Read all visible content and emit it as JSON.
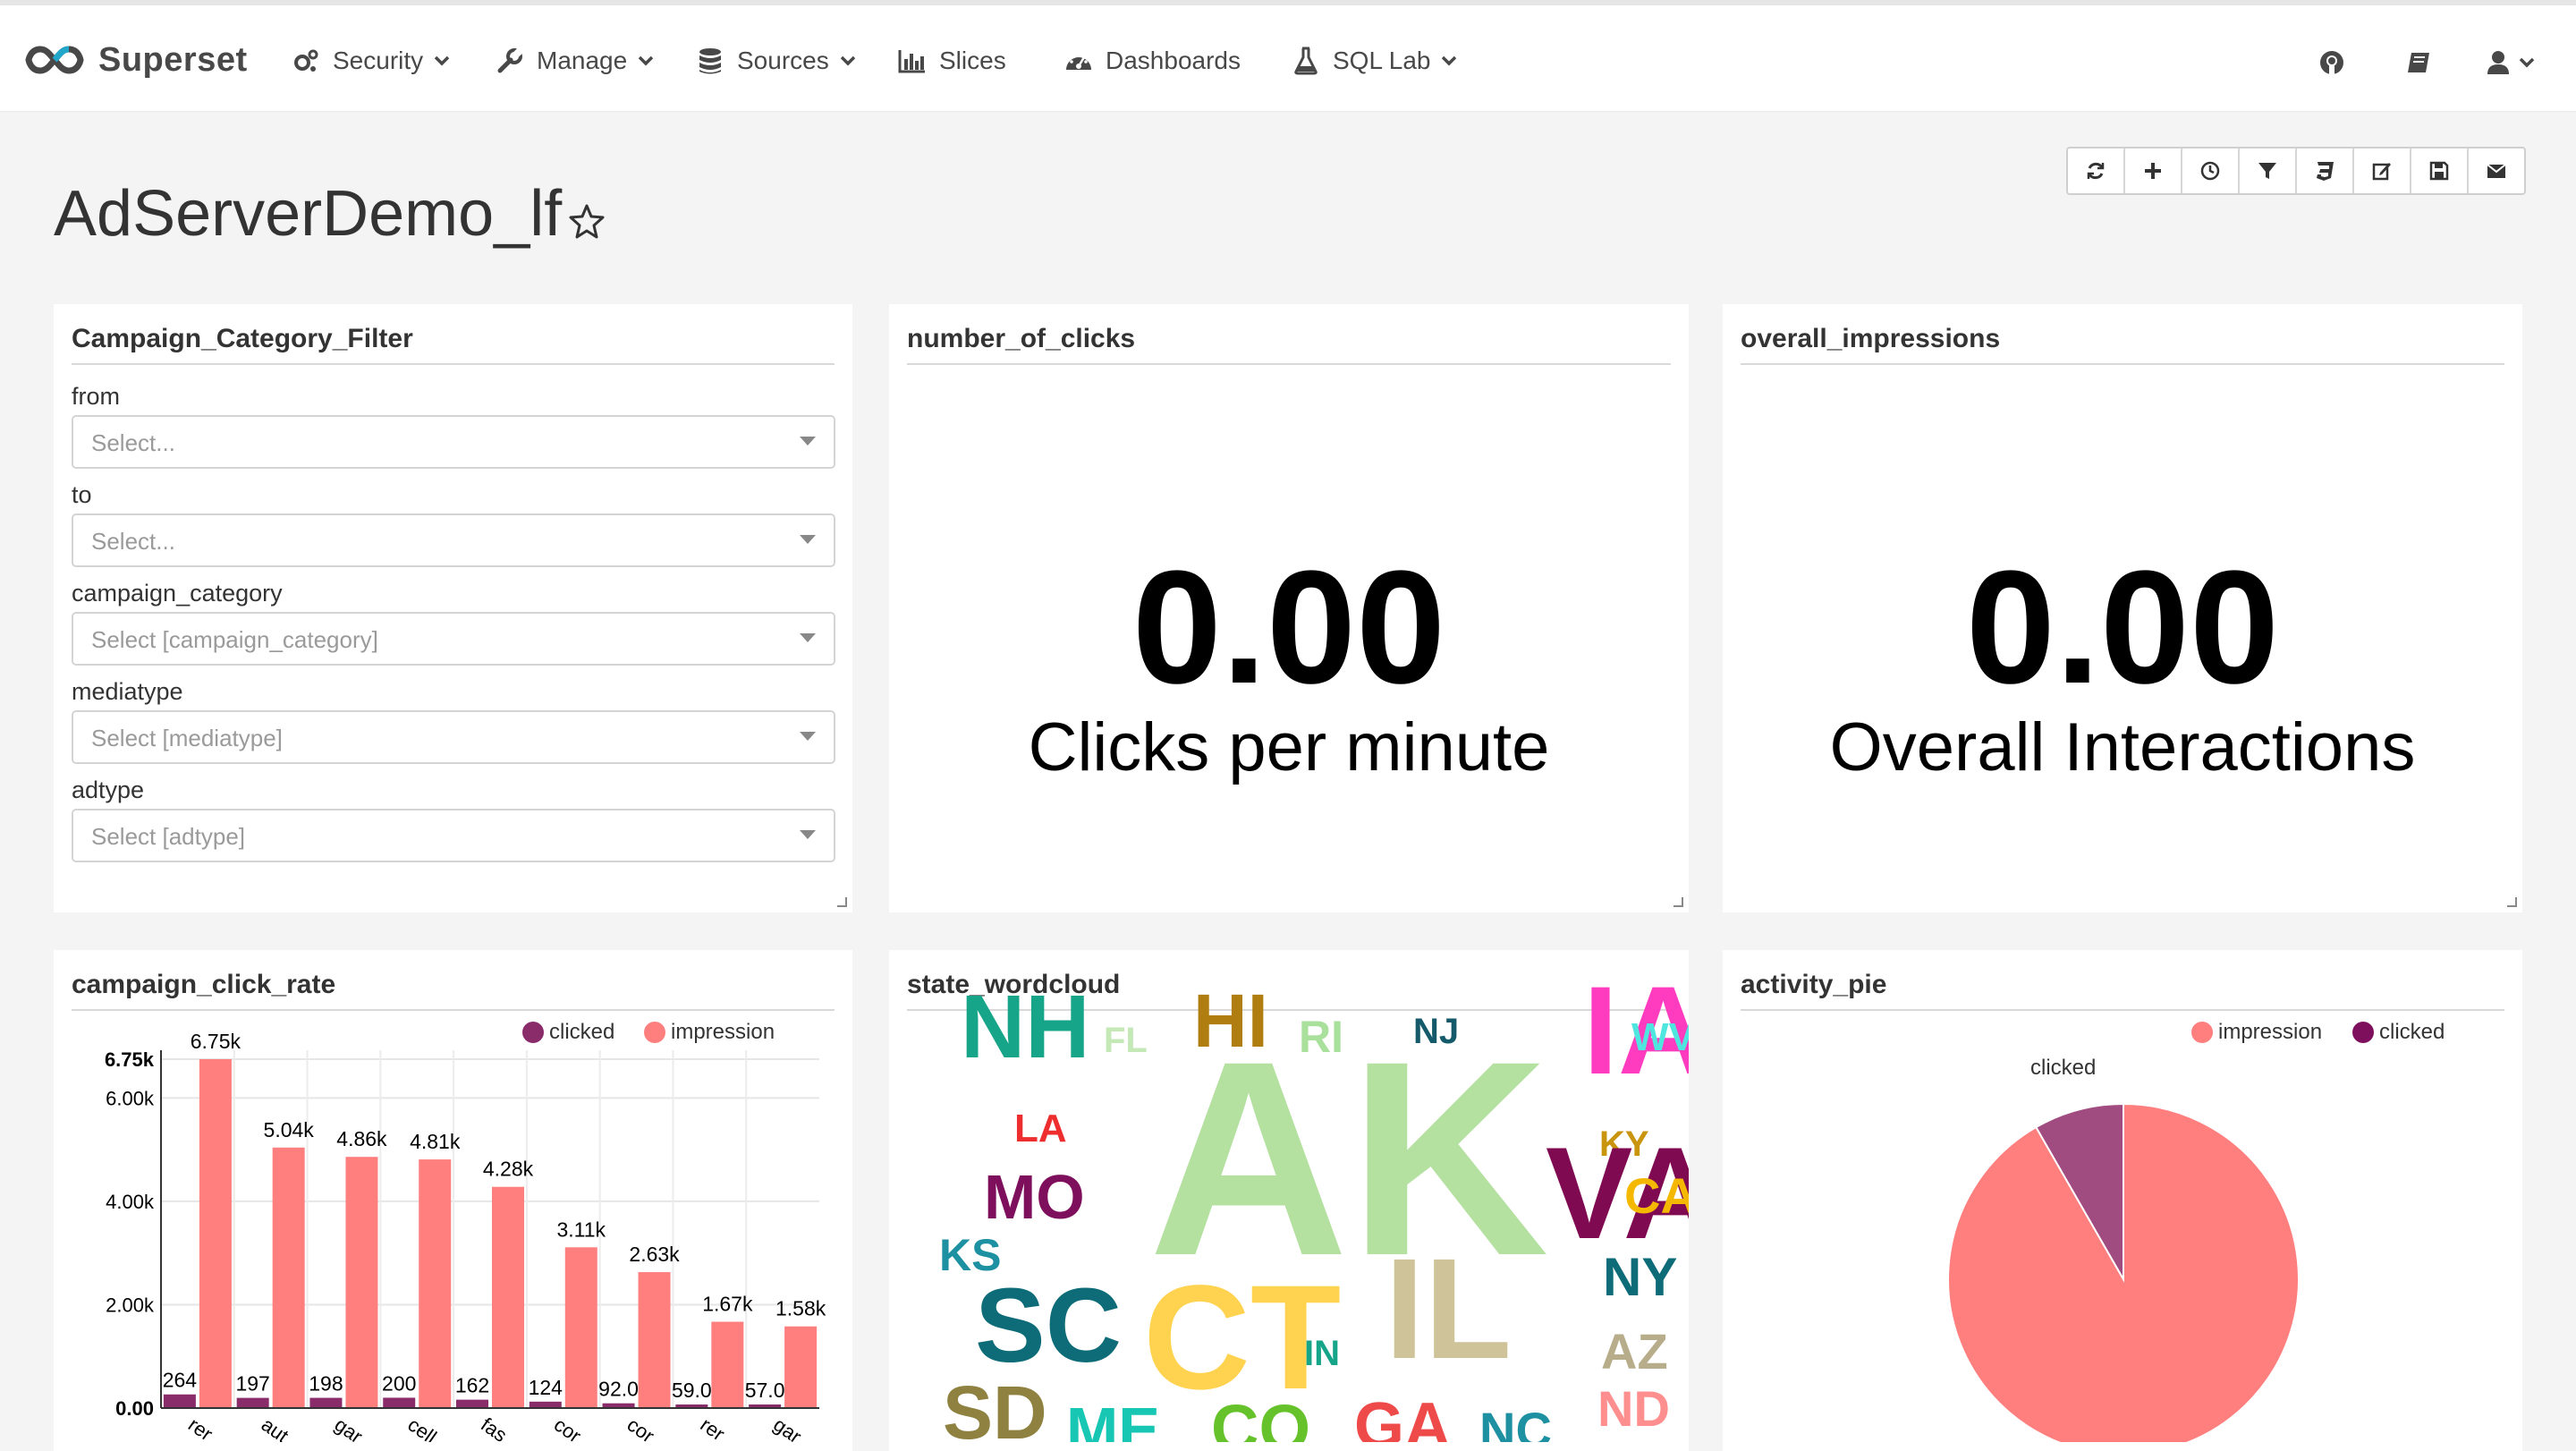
{
  "app": {
    "name": "Superset"
  },
  "nav": {
    "security": "Security",
    "manage": "Manage",
    "sources": "Sources",
    "slices": "Slices",
    "dashboards": "Dashboards",
    "sqllab": "SQL Lab"
  },
  "dashboard": {
    "title": "AdServerDemo_lf"
  },
  "filter_panel": {
    "title": "Campaign_Category_Filter",
    "fields": [
      {
        "label": "from",
        "placeholder": "Select..."
      },
      {
        "label": "to",
        "placeholder": "Select..."
      },
      {
        "label": "campaign_category",
        "placeholder": "Select [campaign_category]"
      },
      {
        "label": "mediatype",
        "placeholder": "Select [mediatype]"
      },
      {
        "label": "adtype",
        "placeholder": "Select [adtype]"
      }
    ]
  },
  "clicks_panel": {
    "title": "number_of_clicks",
    "value": "0.00",
    "subheader": "Clicks per minute"
  },
  "impressions_panel": {
    "title": "overall_impressions",
    "value": "0.00",
    "subheader": "Overall Interactions"
  },
  "click_rate_panel": {
    "title": "campaign_click_rate",
    "legend": [
      "clicked",
      "impression"
    ]
  },
  "wordcloud_panel": {
    "title": "state_wordcloud"
  },
  "pie_panel": {
    "title": "activity_pie",
    "legend": [
      "impression",
      "clicked"
    ],
    "slice_label": "clicked"
  },
  "colors": {
    "impression": "#ff7f7f",
    "clicked": "#8a2b6a",
    "clicked_pie": "#a14c80"
  },
  "chart_data": [
    {
      "type": "bar",
      "title": "campaign_click_rate",
      "categories": [
        "rer",
        "aut",
        "gar",
        "cell",
        "fas",
        "cor",
        "cor",
        "rer",
        "gar"
      ],
      "series": [
        {
          "name": "clicked",
          "values": [
            264,
            197,
            198,
            200,
            162,
            124,
            92.0,
            59.0,
            57.0
          ],
          "labels": [
            "264",
            "197",
            "198",
            "200",
            "162",
            "124",
            "92.0",
            "59.0",
            "57.0"
          ]
        },
        {
          "name": "impression",
          "values": [
            6750,
            5040,
            4860,
            4810,
            4280,
            3110,
            2630,
            1670,
            1580
          ],
          "labels": [
            "6.75k",
            "5.04k",
            "4.86k",
            "4.81k",
            "4.28k",
            "3.11k",
            "2.63k",
            "1.67k",
            "1.58k"
          ]
        }
      ],
      "yticks": [
        0,
        2000,
        4000,
        6000,
        6750
      ],
      "ytick_labels": [
        "0.00",
        "2.00k",
        "4.00k",
        "6.00k",
        "6.75k"
      ],
      "ylim": [
        0,
        6750
      ],
      "grid": true,
      "legend": "top-right"
    },
    {
      "type": "pie",
      "title": "activity_pie",
      "labels": [
        "impression",
        "clicked"
      ],
      "values": [
        91.7,
        8.3
      ],
      "legend": "top-right"
    },
    {
      "type": "wordcloud",
      "title": "state_wordcloud",
      "words": [
        {
          "text": "AK",
          "color": "#b4e0a0"
        },
        {
          "text": "NH",
          "color": "#17a589"
        },
        {
          "text": "FL",
          "color": "#c5e8b7"
        },
        {
          "text": "HI",
          "color": "#b07d10"
        },
        {
          "text": "RI",
          "color": "#a8e09c"
        },
        {
          "text": "NJ",
          "color": "#145a6a"
        },
        {
          "text": "IA",
          "color": "#ff3cbf"
        },
        {
          "text": "WV",
          "color": "#4fe6e0"
        },
        {
          "text": "LA",
          "color": "#ee2e2e"
        },
        {
          "text": "MO",
          "color": "#7d0f5c"
        },
        {
          "text": "KY",
          "color": "#c9950f"
        },
        {
          "text": "VA",
          "color": "#800a52"
        },
        {
          "text": "CA",
          "color": "#f5b800"
        },
        {
          "text": "KS",
          "color": "#1d91a1"
        },
        {
          "text": "SC",
          "color": "#0e6c78"
        },
        {
          "text": "CT",
          "color": "#ffd24f"
        },
        {
          "text": "IL",
          "color": "#cfc39a"
        },
        {
          "text": "NY",
          "color": "#0e6c78"
        },
        {
          "text": "IN",
          "color": "#17a589"
        },
        {
          "text": "AZ",
          "color": "#b7ad8a"
        },
        {
          "text": "SD",
          "color": "#8f8140"
        },
        {
          "text": "ME",
          "color": "#17c7b3"
        },
        {
          "text": "CO",
          "color": "#66c22b"
        },
        {
          "text": "GA",
          "color": "#ee4a4a"
        },
        {
          "text": "NC",
          "color": "#1d91a1"
        },
        {
          "text": "ND",
          "color": "#ff8f8f"
        }
      ]
    }
  ]
}
